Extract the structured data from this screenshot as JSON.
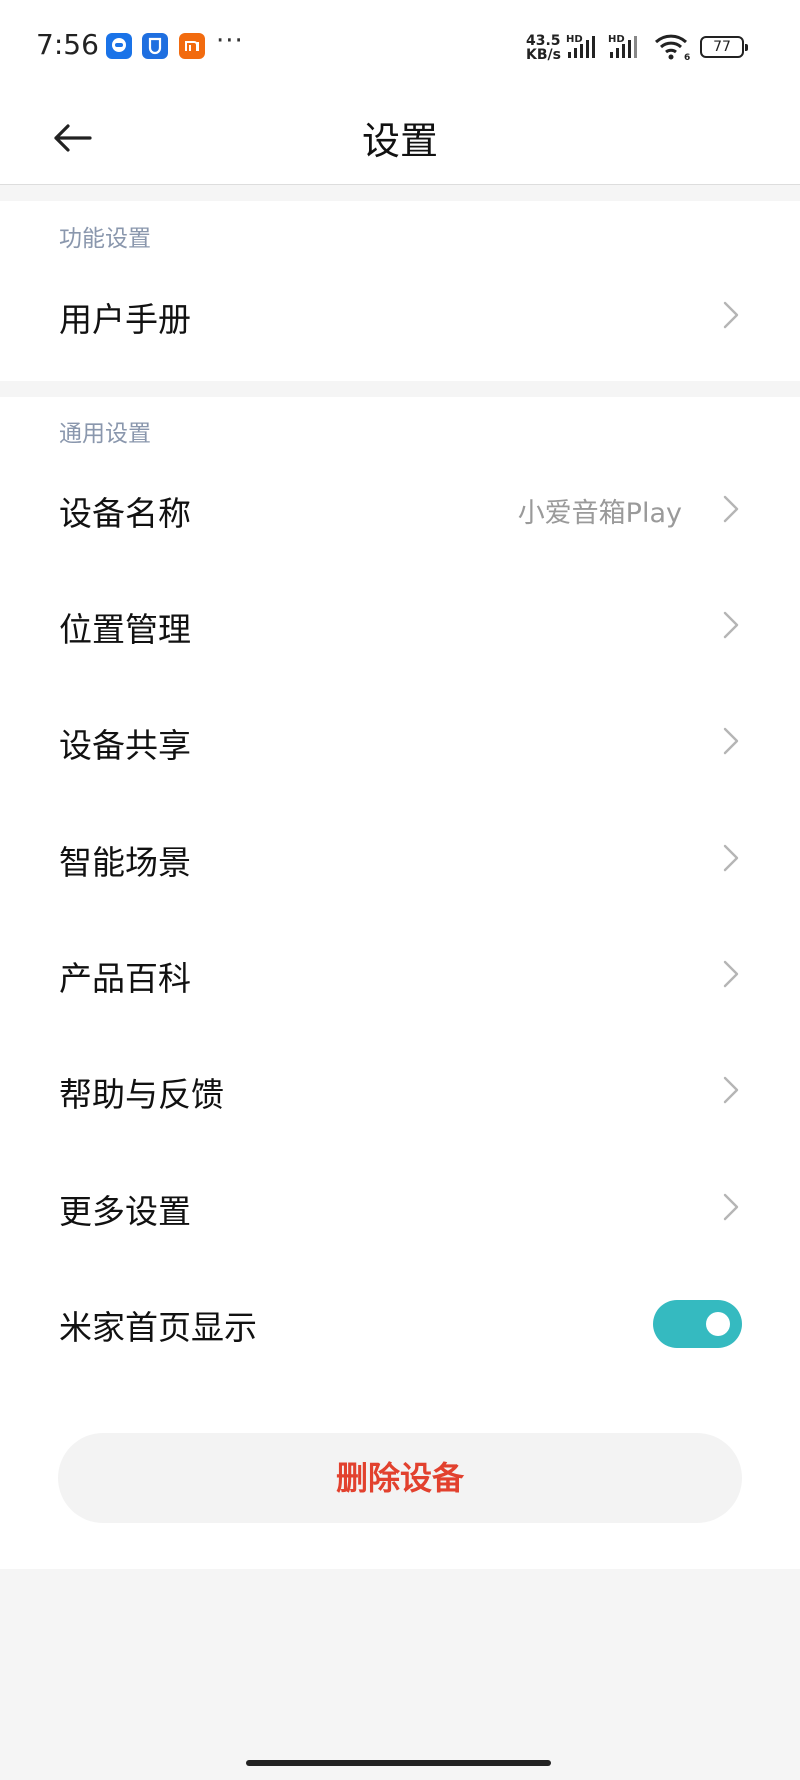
{
  "status_bar": {
    "time": "7:56",
    "net_speed_value": "43.5",
    "net_speed_unit": "KB/s",
    "hd_label_1": "HD",
    "hd_label_2": "HD",
    "wifi_label": "6",
    "battery": "77",
    "more_label": "···",
    "app_icons": [
      "robot-app-icon",
      "shield-app-icon",
      "mi-app-icon"
    ],
    "colors": {
      "robot": "#1a73e8",
      "shield": "#1f6fe0",
      "mi": "#f26b0f"
    }
  },
  "header": {
    "title": "设置"
  },
  "sections": {
    "function": {
      "title": "功能设置",
      "items": [
        {
          "label": "用户手册"
        }
      ]
    },
    "general": {
      "title": "通用设置",
      "items": [
        {
          "label": "设备名称",
          "value": "小爱音箱Play"
        },
        {
          "label": "位置管理"
        },
        {
          "label": "设备共享"
        },
        {
          "label": "智能场景"
        },
        {
          "label": "产品百科"
        },
        {
          "label": "帮助与反馈"
        },
        {
          "label": "更多设置"
        },
        {
          "label": "米家首页显示",
          "toggle_on": true
        }
      ]
    }
  },
  "delete_button": {
    "label": "删除设备"
  },
  "colors": {
    "accent": "#35bac0",
    "danger": "#e2412e",
    "section_title": "#8a97ad",
    "background": "#f5f5f5"
  }
}
